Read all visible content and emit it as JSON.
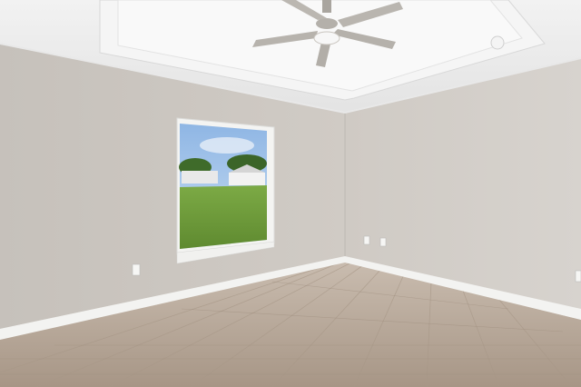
{
  "scene": {
    "description_free": true,
    "icons": {
      "fan": "ceiling-fan-icon",
      "smoke": "smoke-detector-icon",
      "outlet": "power-outlet-icon"
    },
    "colors": {
      "left_wall": "#cdc8c2",
      "right_wall": "#d3d0cb",
      "ceiling": "#eeeeee",
      "floor": "#b7a898",
      "sky": "#9fc3ea",
      "grass": "#6f9b3c"
    }
  }
}
